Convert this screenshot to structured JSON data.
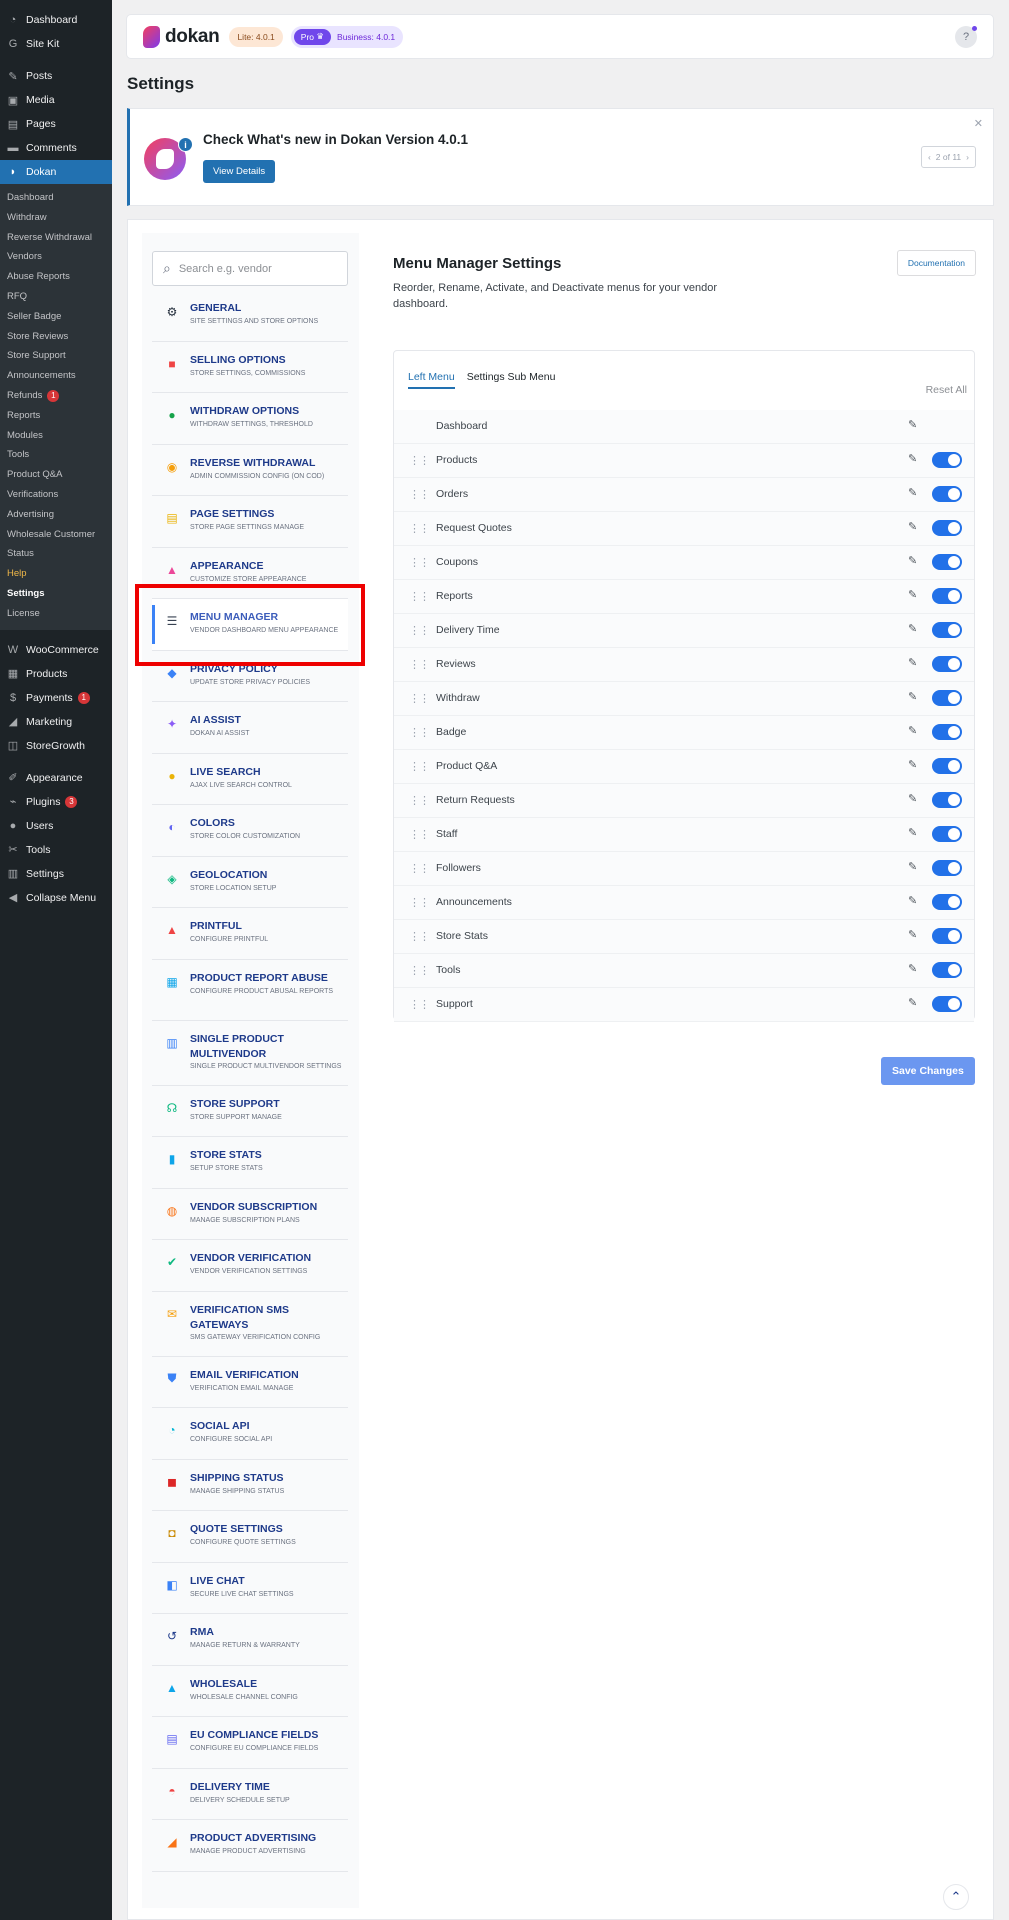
{
  "wp_menu": {
    "top": [
      {
        "name": "dashboard",
        "icon": "gauge-icon",
        "label": "Dashboard"
      },
      {
        "name": "site-kit",
        "icon": "google-icon",
        "label": "Site Kit"
      }
    ],
    "content": [
      {
        "name": "posts",
        "icon": "pin-icon",
        "label": "Posts"
      },
      {
        "name": "media",
        "icon": "media-icon",
        "label": "Media"
      },
      {
        "name": "pages",
        "icon": "page-icon",
        "label": "Pages"
      },
      {
        "name": "comments",
        "icon": "comment-icon",
        "label": "Comments"
      },
      {
        "name": "dokan",
        "icon": "dokan-icon",
        "label": "Dokan"
      }
    ],
    "dokan_sub": [
      {
        "label": "Dashboard"
      },
      {
        "label": "Withdraw"
      },
      {
        "label": "Reverse Withdrawal"
      },
      {
        "label": "Vendors"
      },
      {
        "label": "Abuse Reports"
      },
      {
        "label": "RFQ"
      },
      {
        "label": "Seller Badge"
      },
      {
        "label": "Store Reviews"
      },
      {
        "label": "Store Support"
      },
      {
        "label": "Announcements"
      },
      {
        "label": "Refunds",
        "count": "1"
      },
      {
        "label": "Reports"
      },
      {
        "label": "Modules"
      },
      {
        "label": "Tools"
      },
      {
        "label": "Product Q&A"
      },
      {
        "label": "Verifications"
      },
      {
        "label": "Advertising"
      },
      {
        "label": "Wholesale Customer"
      },
      {
        "label": "Status"
      },
      {
        "label": "Help"
      },
      {
        "label": "Settings"
      },
      {
        "label": "License"
      }
    ],
    "commerce": [
      {
        "name": "woocommerce",
        "icon": "woo-icon",
        "label": "WooCommerce"
      },
      {
        "name": "products",
        "icon": "box-icon",
        "label": "Products"
      },
      {
        "name": "payments",
        "icon": "dollar-icon",
        "label": "Payments",
        "count": "1"
      },
      {
        "name": "marketing",
        "icon": "megaphone-icon",
        "label": "Marketing"
      },
      {
        "name": "storegrowth",
        "icon": "growth-icon",
        "label": "StoreGrowth"
      }
    ],
    "admin": [
      {
        "name": "appearance",
        "icon": "brush-icon",
        "label": "Appearance"
      },
      {
        "name": "plugins",
        "icon": "plug-icon",
        "label": "Plugins",
        "count": "3"
      },
      {
        "name": "users",
        "icon": "user-icon",
        "label": "Users"
      },
      {
        "name": "tools",
        "icon": "wrench-icon",
        "label": "Tools"
      },
      {
        "name": "settings",
        "icon": "settings-icon",
        "label": "Settings"
      },
      {
        "name": "collapse-menu",
        "icon": "collapse-icon",
        "label": "Collapse Menu"
      }
    ]
  },
  "header": {
    "logo_text": "dokan",
    "lite_version": "Lite: 4.0.1",
    "pro_label": "Pro",
    "business_version": "Business: 4.0.1",
    "help_icon_label": "?"
  },
  "page_title": "Settings",
  "notice": {
    "title": "Check What's new in Dokan Version 4.0.1",
    "button": "View Details",
    "pager": "2 of 11",
    "info_glyph": "i"
  },
  "search": {
    "placeholder": "Search e.g. vendor"
  },
  "nav": [
    {
      "title": "GENERAL",
      "sub": "SITE SETTINGS AND STORE OPTIONS",
      "icon": "gear-icon",
      "glyph": "⚙",
      "color": "#1f2937"
    },
    {
      "title": "SELLING OPTIONS",
      "sub": "STORE SETTINGS, COMMISSIONS",
      "icon": "shop-icon",
      "glyph": "■",
      "color": "#ef4444"
    },
    {
      "title": "WITHDRAW OPTIONS",
      "sub": "WITHDRAW SETTINGS, THRESHOLD",
      "icon": "wallet-icon",
      "glyph": "●",
      "color": "#16a34a"
    },
    {
      "title": "REVERSE WITHDRAWAL",
      "sub": "ADMIN COMMISSION CONFIG (ON COD)",
      "icon": "reverse-icon",
      "glyph": "◉",
      "color": "#f59e0b"
    },
    {
      "title": "PAGE SETTINGS",
      "sub": "STORE PAGE SETTINGS MANAGE",
      "icon": "page-settings-icon",
      "glyph": "▤",
      "color": "#eab308"
    },
    {
      "title": "APPEARANCE",
      "sub": "CUSTOMIZE STORE APPEARANCE",
      "icon": "appearance-icon",
      "glyph": "▲",
      "color": "#ec4899"
    },
    {
      "title": "MENU MANAGER",
      "sub": "VENDOR DASHBOARD MENU APPEARANCE",
      "icon": "list-icon",
      "glyph": "☰",
      "color": "#374151",
      "active": true
    },
    {
      "title": "PRIVACY POLICY",
      "sub": "UPDATE STORE PRIVACY POLICIES",
      "icon": "privacy-icon",
      "glyph": "◆",
      "color": "#3b82f6"
    },
    {
      "title": "AI ASSIST",
      "sub": "DOKAN AI ASSIST",
      "icon": "sparkle-icon",
      "glyph": "✦",
      "color": "#8b5cf6"
    },
    {
      "title": "LIVE SEARCH",
      "sub": "AJAX LIVE SEARCH CONTROL",
      "icon": "live-search-icon",
      "glyph": "●",
      "color": "#eab308"
    },
    {
      "title": "COLORS",
      "sub": "STORE COLOR CUSTOMIZATION",
      "icon": "palette-icon",
      "glyph": "◐",
      "color": "#6366f1"
    },
    {
      "title": "GEOLOCATION",
      "sub": "STORE LOCATION SETUP",
      "icon": "map-pin-icon",
      "glyph": "◈",
      "color": "#10b981"
    },
    {
      "title": "PRINTFUL",
      "sub": "CONFIGURE PRINTFUL",
      "icon": "printful-icon",
      "glyph": "▲",
      "color": "#ef4444"
    },
    {
      "title": "PRODUCT REPORT ABUSE",
      "sub": "CONFIGURE PRODUCT ABUSAL REPORTS",
      "icon": "report-icon",
      "glyph": "▦",
      "color": "#0ea5e9"
    },
    {
      "title": "SINGLE PRODUCT MULTIVENDOR",
      "sub": "SINGLE PRODUCT MULTIVENDOR SETTINGS",
      "icon": "multivendor-icon",
      "glyph": "▥",
      "color": "#3b82f6"
    },
    {
      "title": "STORE SUPPORT",
      "sub": "STORE SUPPORT MANAGE",
      "icon": "headset-icon",
      "glyph": "☊",
      "color": "#10b981"
    },
    {
      "title": "STORE STATS",
      "sub": "SETUP STORE STATS",
      "icon": "stats-icon",
      "glyph": "▮",
      "color": "#0ea5e9"
    },
    {
      "title": "VENDOR SUBSCRIPTION",
      "sub": "MANAGE SUBSCRIPTION PLANS",
      "icon": "subscription-icon",
      "glyph": "◍",
      "color": "#f97316"
    },
    {
      "title": "VENDOR VERIFICATION",
      "sub": "VENDOR VERIFICATION SETTINGS",
      "icon": "verification-icon",
      "glyph": "✔",
      "color": "#10b981"
    },
    {
      "title": "VERIFICATION SMS GATEWAYS",
      "sub": "SMS GATEWAY VERIFICATION CONFIG",
      "icon": "sms-icon",
      "glyph": "✉",
      "color": "#f59e0b"
    },
    {
      "title": "EMAIL VERIFICATION",
      "sub": "VERIFICATION EMAIL MANAGE",
      "icon": "shield-icon",
      "glyph": "⛊",
      "color": "#3b82f6"
    },
    {
      "title": "SOCIAL API",
      "sub": "CONFIGURE SOCIAL API",
      "icon": "social-icon",
      "glyph": "◔",
      "color": "#06b6d4"
    },
    {
      "title": "SHIPPING STATUS",
      "sub": "MANAGE SHIPPING STATUS",
      "icon": "shipping-icon",
      "glyph": "◼",
      "color": "#dc2626"
    },
    {
      "title": "QUOTE SETTINGS",
      "sub": "CONFIGURE QUOTE SETTINGS",
      "icon": "quote-icon",
      "glyph": "◘",
      "color": "#ca8a04"
    },
    {
      "title": "LIVE CHAT",
      "sub": "SECURE LIVE CHAT SETTINGS",
      "icon": "chat-icon",
      "glyph": "◧",
      "color": "#3b82f6"
    },
    {
      "title": "RMA",
      "sub": "MANAGE RETURN & WARRANTY",
      "icon": "rma-icon",
      "glyph": "↺",
      "color": "#1e3a8a"
    },
    {
      "title": "WHOLESALE",
      "sub": "WHOLESALE CHANNEL CONFIG",
      "icon": "wholesale-icon",
      "glyph": "▲",
      "color": "#0ea5e9"
    },
    {
      "title": "EU COMPLIANCE FIELDS",
      "sub": "CONFIGURE EU COMPLIANCE FIELDS",
      "icon": "eu-icon",
      "glyph": "▤",
      "color": "#6366f1"
    },
    {
      "title": "DELIVERY TIME",
      "sub": "DELIVERY SCHEDULE SETUP",
      "icon": "delivery-icon",
      "glyph": "◓",
      "color": "#ef4444"
    },
    {
      "title": "PRODUCT ADVERTISING",
      "sub": "MANAGE PRODUCT ADVERTISING",
      "icon": "megaphone-icon",
      "glyph": "◢",
      "color": "#f97316"
    }
  ],
  "menu_manager": {
    "title": "Menu Manager Settings",
    "description": "Reorder, Rename, Activate, and Deactivate menus for your vendor dashboard.",
    "documentation": "Documentation",
    "tabs": [
      "Left Menu",
      "Settings Sub Menu"
    ],
    "active_tab": "Left Menu",
    "reset_all": "Reset All",
    "items": [
      {
        "label": "Dashboard",
        "draggable": false,
        "toggle": false
      },
      {
        "label": "Products",
        "draggable": true,
        "toggle": true,
        "enabled": true
      },
      {
        "label": "Orders",
        "draggable": true,
        "toggle": true,
        "enabled": true
      },
      {
        "label": "Request Quotes",
        "draggable": true,
        "toggle": true,
        "enabled": true
      },
      {
        "label": "Coupons",
        "draggable": true,
        "toggle": true,
        "enabled": true
      },
      {
        "label": "Reports",
        "draggable": true,
        "toggle": true,
        "enabled": true
      },
      {
        "label": "Delivery Time",
        "draggable": true,
        "toggle": true,
        "enabled": true
      },
      {
        "label": "Reviews",
        "draggable": true,
        "toggle": true,
        "enabled": true
      },
      {
        "label": "Withdraw",
        "draggable": true,
        "toggle": true,
        "enabled": true
      },
      {
        "label": "Badge",
        "draggable": true,
        "toggle": true,
        "enabled": true
      },
      {
        "label": "Product Q&A",
        "draggable": true,
        "toggle": true,
        "enabled": true
      },
      {
        "label": "Return Requests",
        "draggable": true,
        "toggle": true,
        "enabled": true
      },
      {
        "label": "Staff",
        "draggable": true,
        "toggle": true,
        "enabled": true
      },
      {
        "label": "Followers",
        "draggable": true,
        "toggle": true,
        "enabled": true
      },
      {
        "label": "Announcements",
        "draggable": true,
        "toggle": true,
        "enabled": true
      },
      {
        "label": "Store Stats",
        "draggable": true,
        "toggle": true,
        "enabled": true
      },
      {
        "label": "Tools",
        "draggable": true,
        "toggle": true,
        "enabled": true
      },
      {
        "label": "Support",
        "draggable": true,
        "toggle": true,
        "enabled": true
      }
    ],
    "save_button": "Save Changes"
  }
}
